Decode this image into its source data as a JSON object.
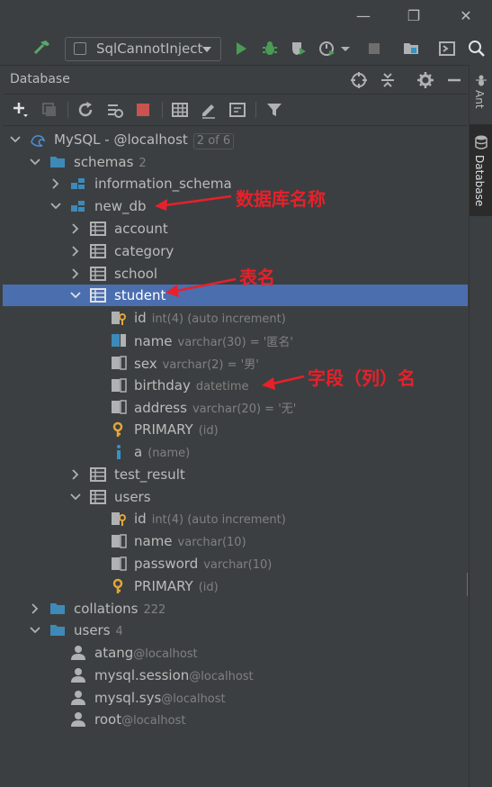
{
  "window": {
    "controls": [
      "—",
      "❐",
      "✕"
    ]
  },
  "toolbar": {
    "run_config": "SqlCannotInject"
  },
  "panel": {
    "title": "Database"
  },
  "right_strip": {
    "tabs": [
      "Ant",
      "Database"
    ]
  },
  "tree": {
    "connection": {
      "label": "MySQL - @localhost",
      "badge": "2 of 6"
    },
    "schemas": {
      "label": "schemas",
      "count": "2"
    },
    "information_schema": "information_schema",
    "new_db": "new_db",
    "tables": {
      "account": "account",
      "category": "category",
      "school": "school",
      "student": "student",
      "test_result": "test_result",
      "users": "users"
    },
    "student_columns": [
      {
        "name": "id",
        "type": "int(4) (auto increment)"
      },
      {
        "name": "name",
        "type": "varchar(30) = '匿名'"
      },
      {
        "name": "sex",
        "type": "varchar(2) = '男'"
      },
      {
        "name": "birthday",
        "type": "datetime"
      },
      {
        "name": "address",
        "type": "varchar(20) = '无'"
      },
      {
        "name": "PRIMARY",
        "type": "(id)"
      },
      {
        "name": "a",
        "type": "(name)"
      }
    ],
    "users_columns": [
      {
        "name": "id",
        "type": "int(4) (auto increment)"
      },
      {
        "name": "name",
        "type": "varchar(10)"
      },
      {
        "name": "password",
        "type": "varchar(10)"
      },
      {
        "name": "PRIMARY",
        "type": "(id)"
      }
    ],
    "collations": {
      "label": "collations",
      "count": "222"
    },
    "users_group": {
      "label": "users",
      "count": "4"
    },
    "users_list": [
      {
        "name": "atang",
        "host": "@localhost"
      },
      {
        "name": "mysql.session",
        "host": "@localhost"
      },
      {
        "name": "mysql.sys",
        "host": "@localhost"
      },
      {
        "name": "root",
        "host": "@localhost"
      }
    ]
  },
  "annotations": {
    "db_name": "数据库名称",
    "table_name": "表名",
    "column_name": "字段（列）名"
  },
  "colors": {
    "selection": "#4b6eaf",
    "annotation": "#e8202a",
    "background": "#3c3f41"
  }
}
